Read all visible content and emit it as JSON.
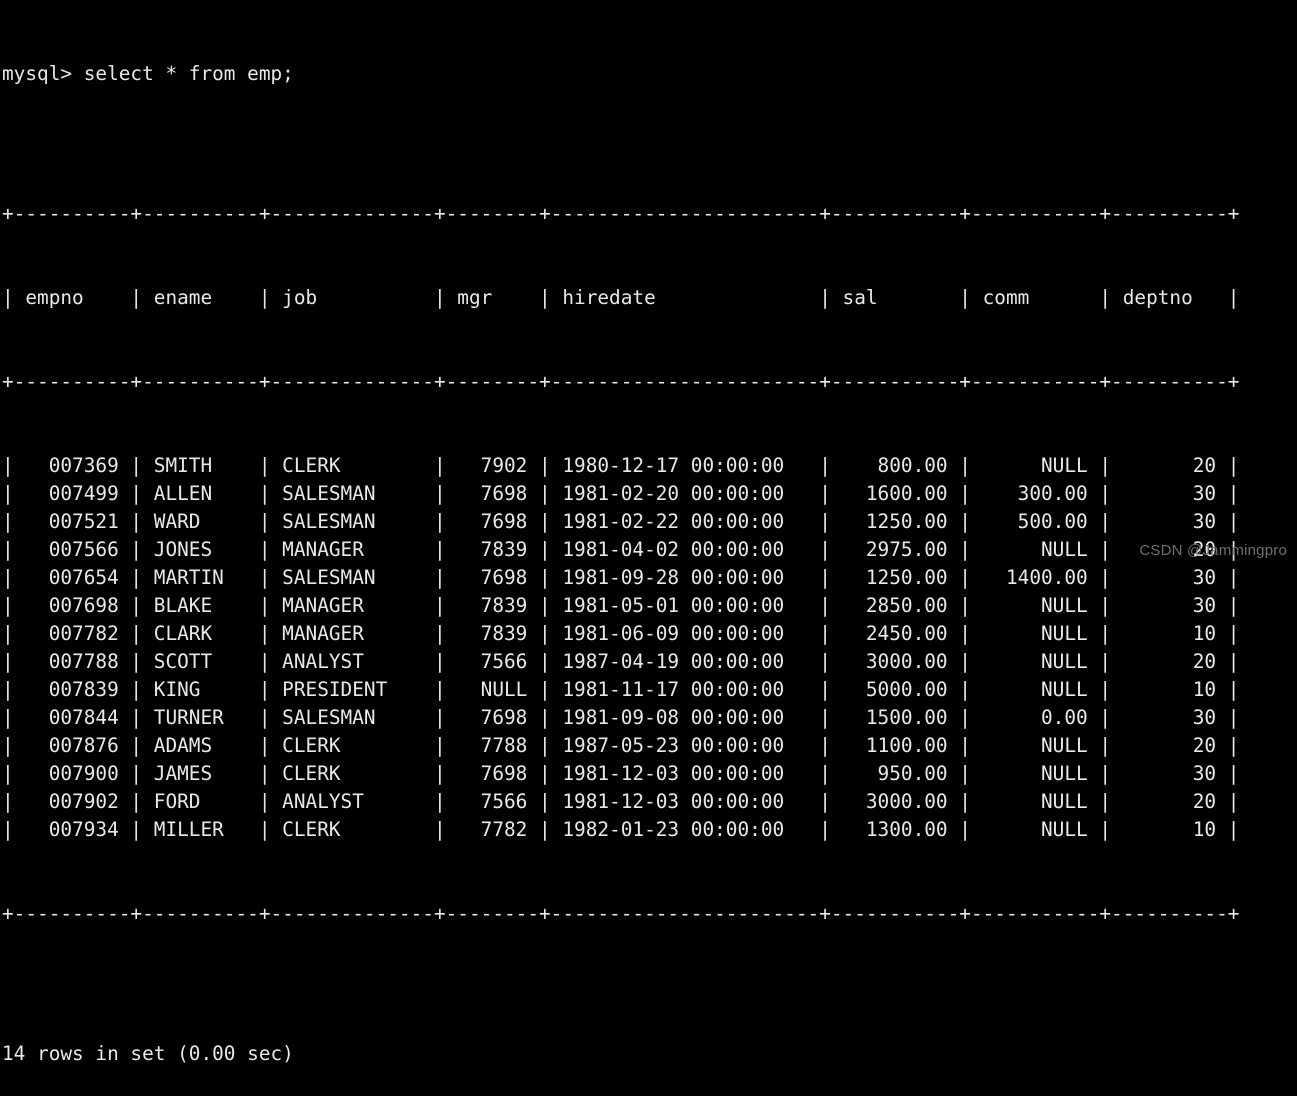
{
  "terminal": {
    "prompt": "mysql>",
    "command": "select * from emp;",
    "prompt_line": "mysql> select * from emp;",
    "status": "14 rows in set (0.00 sec)",
    "background_color": "#000000",
    "text_color": "#e8e8e8"
  },
  "watermark": {
    "text": "CSDN @Jammingpro",
    "color": "#6f6f6f"
  },
  "table": {
    "columns": [
      {
        "name": "empno",
        "width": 8,
        "align": "right"
      },
      {
        "name": "ename",
        "width": 8,
        "align": "left"
      },
      {
        "name": "job",
        "width": 12,
        "align": "left"
      },
      {
        "name": "mgr",
        "width": 6,
        "align": "right"
      },
      {
        "name": "hiredate",
        "width": 21,
        "align": "left"
      },
      {
        "name": "sal",
        "width": 9,
        "align": "right"
      },
      {
        "name": "comm",
        "width": 9,
        "align": "right"
      },
      {
        "name": "deptno",
        "width": 8,
        "align": "right"
      }
    ],
    "headers": [
      "empno",
      "ename",
      "job",
      "mgr",
      "hiredate",
      "sal",
      "comm",
      "deptno"
    ],
    "rows": [
      [
        "007369",
        "SMITH",
        "CLERK",
        "7902",
        "1980-12-17 00:00:00",
        "800.00",
        "NULL",
        "20"
      ],
      [
        "007499",
        "ALLEN",
        "SALESMAN",
        "7698",
        "1981-02-20 00:00:00",
        "1600.00",
        "300.00",
        "30"
      ],
      [
        "007521",
        "WARD",
        "SALESMAN",
        "7698",
        "1981-02-22 00:00:00",
        "1250.00",
        "500.00",
        "30"
      ],
      [
        "007566",
        "JONES",
        "MANAGER",
        "7839",
        "1981-04-02 00:00:00",
        "2975.00",
        "NULL",
        "20"
      ],
      [
        "007654",
        "MARTIN",
        "SALESMAN",
        "7698",
        "1981-09-28 00:00:00",
        "1250.00",
        "1400.00",
        "30"
      ],
      [
        "007698",
        "BLAKE",
        "MANAGER",
        "7839",
        "1981-05-01 00:00:00",
        "2850.00",
        "NULL",
        "30"
      ],
      [
        "007782",
        "CLARK",
        "MANAGER",
        "7839",
        "1981-06-09 00:00:00",
        "2450.00",
        "NULL",
        "10"
      ],
      [
        "007788",
        "SCOTT",
        "ANALYST",
        "7566",
        "1987-04-19 00:00:00",
        "3000.00",
        "NULL",
        "20"
      ],
      [
        "007839",
        "KING",
        "PRESIDENT",
        "NULL",
        "1981-11-17 00:00:00",
        "5000.00",
        "NULL",
        "10"
      ],
      [
        "007844",
        "TURNER",
        "SALESMAN",
        "7698",
        "1981-09-08 00:00:00",
        "1500.00",
        "0.00",
        "30"
      ],
      [
        "007876",
        "ADAMS",
        "CLERK",
        "7788",
        "1987-05-23 00:00:00",
        "1100.00",
        "NULL",
        "20"
      ],
      [
        "007900",
        "JAMES",
        "CLERK",
        "7698",
        "1981-12-03 00:00:00",
        "950.00",
        "NULL",
        "30"
      ],
      [
        "007902",
        "FORD",
        "ANALYST",
        "7566",
        "1981-12-03 00:00:00",
        "3000.00",
        "NULL",
        "20"
      ],
      [
        "007934",
        "MILLER",
        "CLERK",
        "7782",
        "1982-01-23 00:00:00",
        "1300.00",
        "NULL",
        "10"
      ]
    ],
    "row_count": 14
  }
}
